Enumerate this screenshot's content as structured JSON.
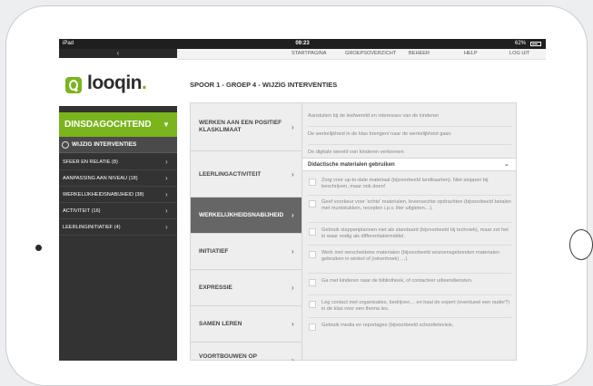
{
  "status": {
    "left": "iPad",
    "time": "09:23",
    "battery": "62%"
  },
  "sidebar": {
    "back_arrow": "‹",
    "logo": {
      "text": "looqin",
      "dot": "."
    },
    "day": {
      "label": "DINSDAGOCHTEND",
      "caret": "▼"
    },
    "current": "WIJZIG INTERVENTIES",
    "items": [
      {
        "label": "SFEER EN RELATIE (8)"
      },
      {
        "label": "AANPASSING AAN NIVEAU (18)"
      },
      {
        "label": "WERKELIJKHEIDSNABIJHEID (38)"
      },
      {
        "label": "ACTIVITEIT (16)"
      },
      {
        "label": "LEERLINGINITIATIEF (4)"
      }
    ]
  },
  "topnav": {
    "items": [
      "STARTPAGINA",
      "GROEPSOVERZICHT",
      "BEHEER",
      "HELP",
      "LOG UIT"
    ]
  },
  "page_title": "SPOOR 1 - GROEP 4 - WIJZIG INTERVENTIES",
  "categories": [
    {
      "label": "WERKEN AAN EEN POSITIEF KLASKLIMAAT",
      "active": false
    },
    {
      "label": "LEERLINGACTIVITEIT",
      "active": false
    },
    {
      "label": "WERKELIJKHEIDSNABIJHEID",
      "active": true
    },
    {
      "label": "INITIATIEF",
      "active": false
    },
    {
      "label": "EXPRESSIE",
      "active": false
    },
    {
      "label": "SAMEN LEREN",
      "active": false
    },
    {
      "label": "VOORTBOUWEN OP MOGELIJKHEDEN",
      "active": false
    }
  ],
  "options": {
    "plain": [
      "Aansluiten bij de leefwereld en interesses van de kinderen",
      "De werkelijkheid in de klas brengen/ naar de werkelijkheid gaan",
      "De digitale wereld van kinderen verkennen"
    ],
    "expanded": {
      "label": "Didactische materialen gebruiken",
      "caret": "⌄"
    },
    "checks": [
      "Zorg voor up-to-date materiaal (bijvoorbeeld landkaarten). Niet stoppen bij beschrijven, maar ook doen!",
      "Geef voorkeur voor 'echte' materialen, levensechte opdrachten (bijvoorbeeld betalen met muntstukken, recepten i.p.v. liter uitgieten…).",
      "Gebruik stappenplannen niet als standaard (bijvoorbeeld bij techniek), maar zet het in waar nodig als differentiatiemiddel.",
      "Werk met verscheidene materialen (bijvoorbeeld seizoensgebonden materialen gebruiken in winkel of (rekenhoek) …).",
      "Ga met kinderen naar de bibliotheek, of contacteer uitleendiensten.",
      "Leg contact met organisaties, bedrijven… en haal de expert (eventueel een ouder?) in de klas voor een thema les.",
      "Gebruik media en reportages (bijvoorbeeld schooltelevisie,"
    ]
  },
  "colors": {
    "accent": "#7ab51d",
    "sidebar": "#333333",
    "active_category": "#666666"
  }
}
